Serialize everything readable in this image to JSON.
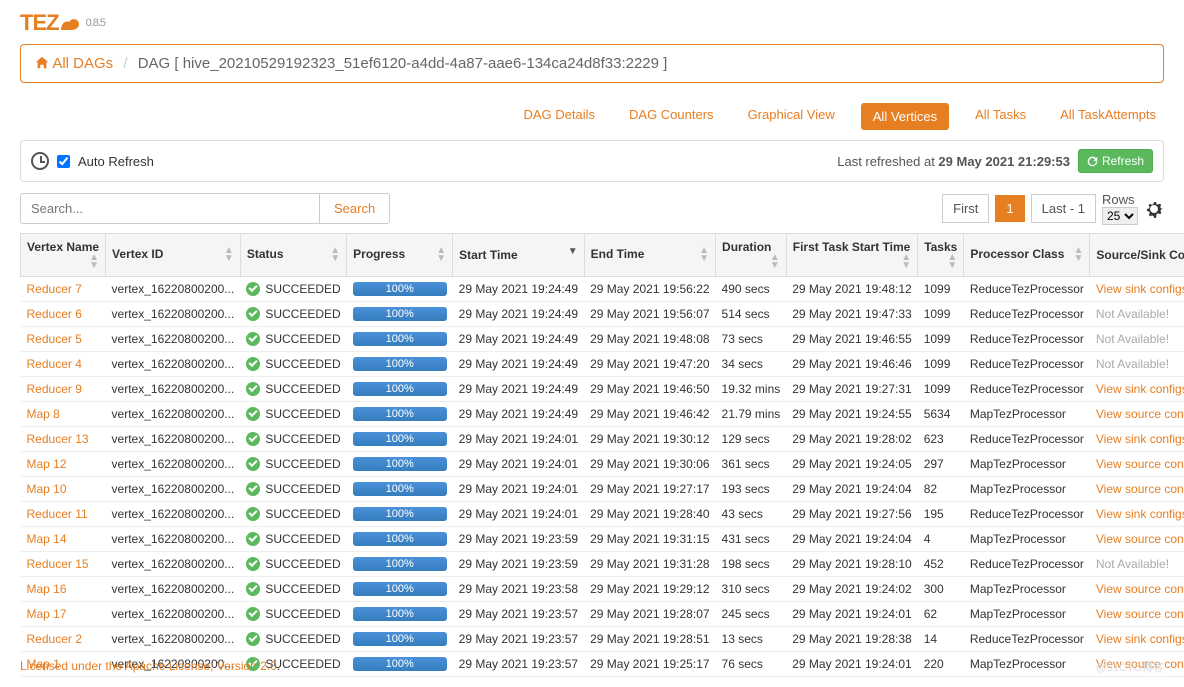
{
  "logo": {
    "text": "TEZ",
    "version": "0.8.5"
  },
  "breadcrumb": {
    "home": "All DAGs",
    "current": "DAG [ hive_20210529192323_51ef6120-a4dd-4a87-aae6-134ca24d8f33:2229 ]"
  },
  "tabs": {
    "details": "DAG Details",
    "counters": "DAG Counters",
    "graph": "Graphical View",
    "vertices": "All Vertices",
    "tasks": "All Tasks",
    "attempts": "All TaskAttempts"
  },
  "refresh": {
    "checkbox_label": "Auto Refresh",
    "status_prefix": "Last refreshed at ",
    "status_time": "29 May 2021 21:29:53",
    "button": "Refresh"
  },
  "search": {
    "placeholder": "Search...",
    "button": "Search"
  },
  "pager": {
    "first": "First",
    "page": "1",
    "last": "Last - 1",
    "rows_label": "Rows",
    "rows_value": "25"
  },
  "columns": {
    "vertex_name": "Vertex Name",
    "vertex_id": "Vertex ID",
    "status": "Status",
    "progress": "Progress",
    "start_time": "Start Time",
    "end_time": "End Time",
    "duration": "Duration",
    "first_task_start_time": "First Task Start Time",
    "tasks": "Tasks",
    "processor_class": "Processor Class",
    "source_sink": "Source/Sink Confi"
  },
  "progress_text": "100%",
  "status_text": "SUCCEEDED",
  "vertex_id_text": "vertex_16220800200...",
  "links": {
    "view_sink": "View sink configs",
    "view_source": "View source config",
    "na": "Not Available!"
  },
  "rows": [
    {
      "name": "Reducer 7",
      "start": "29 May 2021 19:24:49",
      "end": "29 May 2021 19:56:22",
      "duration": "490 secs",
      "first": "29 May 2021 19:48:12",
      "tasks": "1099",
      "proc": "ReduceTezProcessor",
      "cfg": "sink"
    },
    {
      "name": "Reducer 6",
      "start": "29 May 2021 19:24:49",
      "end": "29 May 2021 19:56:07",
      "duration": "514 secs",
      "first": "29 May 2021 19:47:33",
      "tasks": "1099",
      "proc": "ReduceTezProcessor",
      "cfg": "na"
    },
    {
      "name": "Reducer 5",
      "start": "29 May 2021 19:24:49",
      "end": "29 May 2021 19:48:08",
      "duration": "73 secs",
      "first": "29 May 2021 19:46:55",
      "tasks": "1099",
      "proc": "ReduceTezProcessor",
      "cfg": "na"
    },
    {
      "name": "Reducer 4",
      "start": "29 May 2021 19:24:49",
      "end": "29 May 2021 19:47:20",
      "duration": "34 secs",
      "first": "29 May 2021 19:46:46",
      "tasks": "1099",
      "proc": "ReduceTezProcessor",
      "cfg": "na"
    },
    {
      "name": "Reducer 9",
      "start": "29 May 2021 19:24:49",
      "end": "29 May 2021 19:46:50",
      "duration": "19.32 mins",
      "first": "29 May 2021 19:27:31",
      "tasks": "1099",
      "proc": "ReduceTezProcessor",
      "cfg": "sink"
    },
    {
      "name": "Map 8",
      "start": "29 May 2021 19:24:49",
      "end": "29 May 2021 19:46:42",
      "duration": "21.79 mins",
      "first": "29 May 2021 19:24:55",
      "tasks": "5634",
      "proc": "MapTezProcessor",
      "cfg": "source"
    },
    {
      "name": "Reducer 13",
      "start": "29 May 2021 19:24:01",
      "end": "29 May 2021 19:30:12",
      "duration": "129 secs",
      "first": "29 May 2021 19:28:02",
      "tasks": "623",
      "proc": "ReduceTezProcessor",
      "cfg": "sink"
    },
    {
      "name": "Map 12",
      "start": "29 May 2021 19:24:01",
      "end": "29 May 2021 19:30:06",
      "duration": "361 secs",
      "first": "29 May 2021 19:24:05",
      "tasks": "297",
      "proc": "MapTezProcessor",
      "cfg": "source"
    },
    {
      "name": "Map 10",
      "start": "29 May 2021 19:24:01",
      "end": "29 May 2021 19:27:17",
      "duration": "193 secs",
      "first": "29 May 2021 19:24:04",
      "tasks": "82",
      "proc": "MapTezProcessor",
      "cfg": "source"
    },
    {
      "name": "Reducer 11",
      "start": "29 May 2021 19:24:01",
      "end": "29 May 2021 19:28:40",
      "duration": "43 secs",
      "first": "29 May 2021 19:27:56",
      "tasks": "195",
      "proc": "ReduceTezProcessor",
      "cfg": "sink"
    },
    {
      "name": "Map 14",
      "start": "29 May 2021 19:23:59",
      "end": "29 May 2021 19:31:15",
      "duration": "431 secs",
      "first": "29 May 2021 19:24:04",
      "tasks": "4",
      "proc": "MapTezProcessor",
      "cfg": "source"
    },
    {
      "name": "Reducer 15",
      "start": "29 May 2021 19:23:59",
      "end": "29 May 2021 19:31:28",
      "duration": "198 secs",
      "first": "29 May 2021 19:28:10",
      "tasks": "452",
      "proc": "ReduceTezProcessor",
      "cfg": "na"
    },
    {
      "name": "Map 16",
      "start": "29 May 2021 19:23:58",
      "end": "29 May 2021 19:29:12",
      "duration": "310 secs",
      "first": "29 May 2021 19:24:02",
      "tasks": "300",
      "proc": "MapTezProcessor",
      "cfg": "source"
    },
    {
      "name": "Map 17",
      "start": "29 May 2021 19:23:57",
      "end": "29 May 2021 19:28:07",
      "duration": "245 secs",
      "first": "29 May 2021 19:24:01",
      "tasks": "62",
      "proc": "MapTezProcessor",
      "cfg": "source"
    },
    {
      "name": "Reducer 2",
      "start": "29 May 2021 19:23:57",
      "end": "29 May 2021 19:28:51",
      "duration": "13 secs",
      "first": "29 May 2021 19:28:38",
      "tasks": "14",
      "proc": "ReduceTezProcessor",
      "cfg": "sink"
    },
    {
      "name": "Map 1",
      "start": "29 May 2021 19:23:57",
      "end": "29 May 2021 19:25:17",
      "duration": "76 secs",
      "first": "29 May 2021 19:24:01",
      "tasks": "220",
      "proc": "MapTezProcessor",
      "cfg": "source"
    }
  ],
  "footer": "Licensed under the Apache License, Version 2.0",
  "watermark": "@51CTO博客"
}
